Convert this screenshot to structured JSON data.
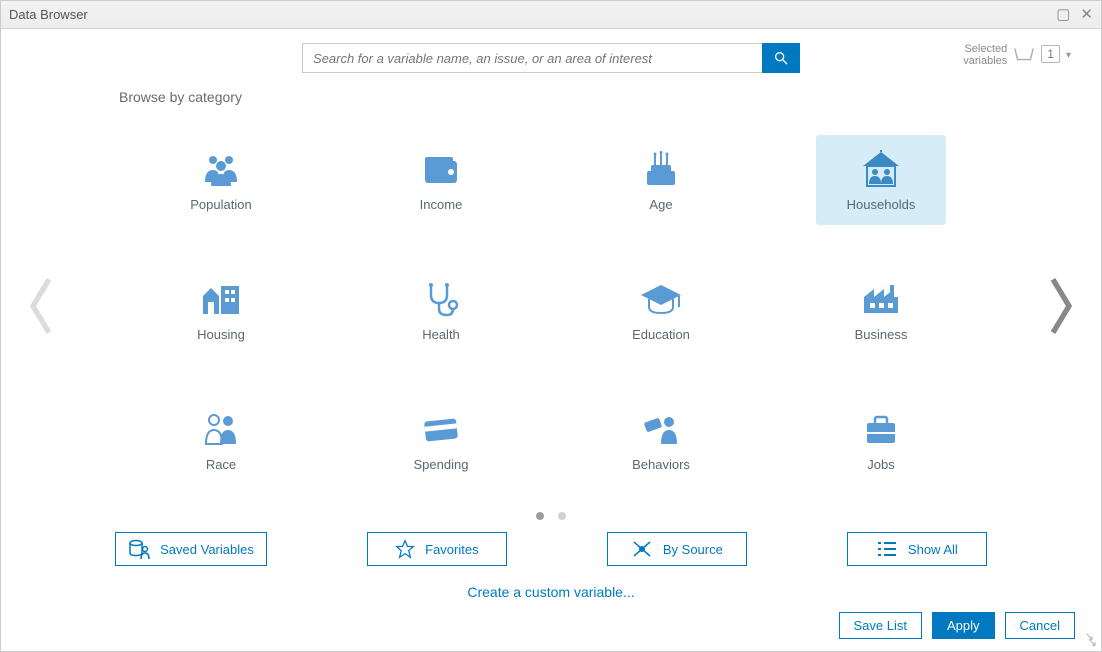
{
  "window": {
    "title": "Data Browser"
  },
  "search": {
    "placeholder": "Search for a variable name, an issue, or an area of interest"
  },
  "selected": {
    "label1": "Selected",
    "label2": "variables",
    "count": "1"
  },
  "browse_label": "Browse by category",
  "categories": [
    {
      "label": "Population"
    },
    {
      "label": "Income"
    },
    {
      "label": "Age"
    },
    {
      "label": "Households"
    },
    {
      "label": "Housing"
    },
    {
      "label": "Health"
    },
    {
      "label": "Education"
    },
    {
      "label": "Business"
    },
    {
      "label": "Race"
    },
    {
      "label": "Spending"
    },
    {
      "label": "Behaviors"
    },
    {
      "label": "Jobs"
    }
  ],
  "options": {
    "saved": "Saved Variables",
    "favorites": "Favorites",
    "bysource": "By Source",
    "showall": "Show All"
  },
  "custom_link": "Create a custom variable...",
  "footer": {
    "save": "Save List",
    "apply": "Apply",
    "cancel": "Cancel"
  }
}
